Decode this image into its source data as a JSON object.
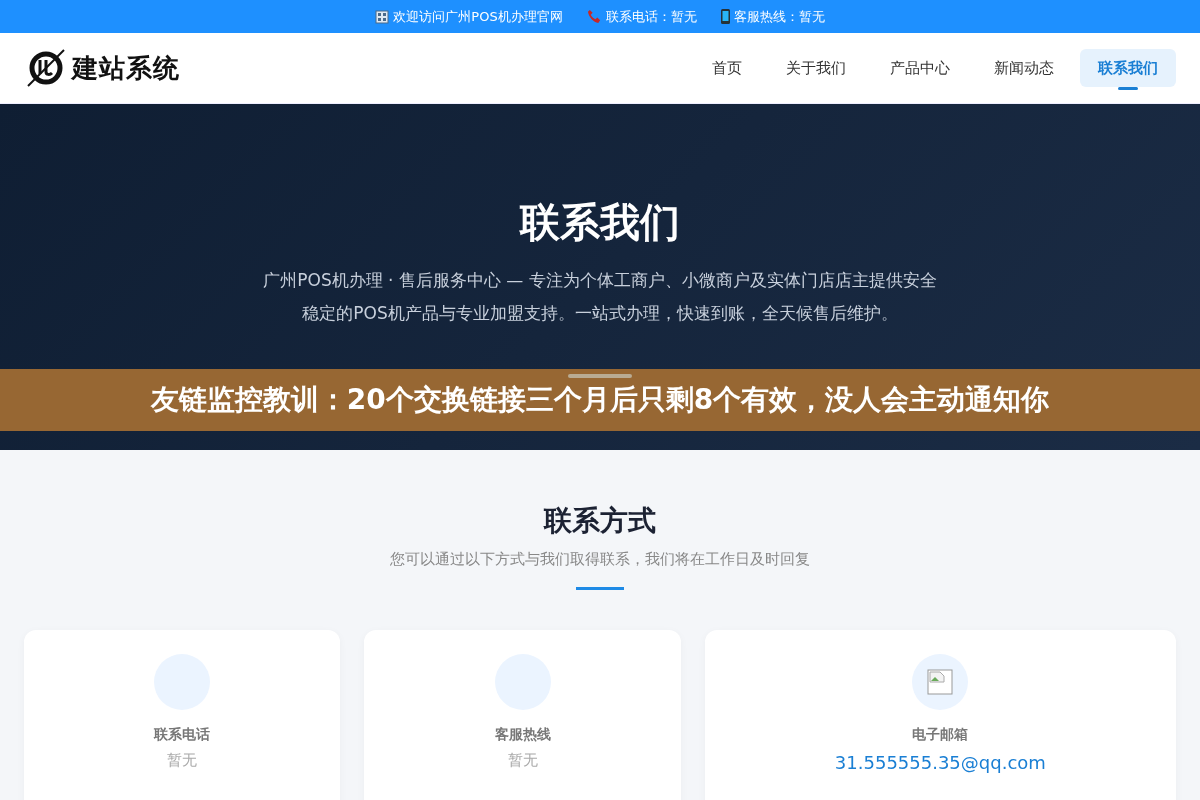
{
  "topbar": {
    "items": [
      {
        "kind": "building",
        "text": "欢迎访问广州POS机办理官网"
      },
      {
        "kind": "phone",
        "text": "联系电话：暂无"
      },
      {
        "kind": "mobile",
        "text": "客服热线：暂无"
      }
    ]
  },
  "nav": {
    "logo_text": "建站系统",
    "items": [
      {
        "label": "首页",
        "selected": false
      },
      {
        "label": "关于我们",
        "selected": false
      },
      {
        "label": "产品中心",
        "selected": false
      },
      {
        "label": "新闻动态",
        "selected": false
      },
      {
        "label": "联系我们",
        "selected": true
      }
    ]
  },
  "hero": {
    "title": "联系我们",
    "description": "广州POS机办理 · 售后服务中心 — 专注为个体工商户、小微商户及实体门店店主提供安全稳定的POS机产品与专业加盟支持。一站式办理，快速到账，全天候售后维护。"
  },
  "banner": {
    "text": "友链监控教训：20个交换链接三个月后只剩8个有效，没人会主动通知你"
  },
  "contact": {
    "title": "联系方式",
    "subtitle": "您可以通过以下方式与我们取得联系，我们将在工作日及时回复",
    "cards": [
      {
        "kind": "empty",
        "label": "联系电话",
        "value": "暂无"
      },
      {
        "kind": "empty",
        "label": "客服热线",
        "value": "暂无"
      },
      {
        "kind": "broken-image",
        "label": "电子邮箱",
        "value": "31.555555.35@qq.com"
      }
    ]
  }
}
